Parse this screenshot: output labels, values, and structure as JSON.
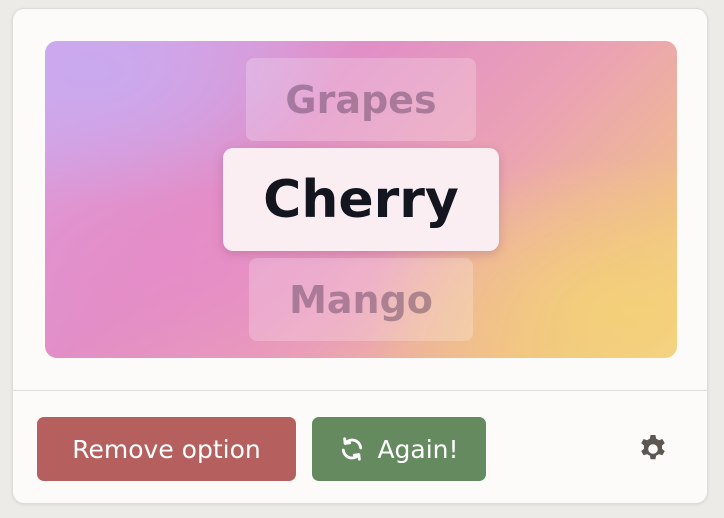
{
  "picker": {
    "previous": "Grapes",
    "current": "Cherry",
    "next": "Mango"
  },
  "actions": {
    "remove_label": "Remove option",
    "again_label": "Again!"
  },
  "icons": {
    "again": "refresh-icon",
    "settings": "gear-icon"
  },
  "colors": {
    "remove_button": "#b5605f",
    "again_button": "#658a5f",
    "gear": "#5c5752"
  }
}
